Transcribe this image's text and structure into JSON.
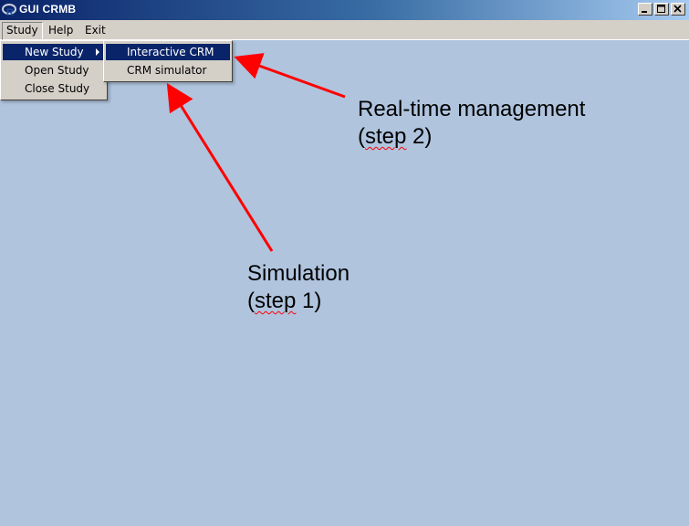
{
  "window": {
    "title": "GUI CRMB"
  },
  "menubar": {
    "items": [
      {
        "label": "Study"
      },
      {
        "label": "Help"
      },
      {
        "label": "Exit"
      }
    ]
  },
  "study_menu": {
    "items": [
      {
        "label": "New Study"
      },
      {
        "label": "Open Study"
      },
      {
        "label": "Close Study"
      }
    ]
  },
  "new_study_submenu": {
    "items": [
      {
        "label": "Interactive CRM"
      },
      {
        "label": "CRM simulator"
      }
    ]
  },
  "annotations": {
    "realtime": {
      "line1": "Real-time management",
      "line2_prefix": "(",
      "line2_word": "step",
      "line2_suffix": " 2)"
    },
    "simulation": {
      "line1": "Simulation",
      "line2_prefix": "(",
      "line2_word": "step",
      "line2_suffix": " 1)"
    }
  },
  "colors": {
    "workspace": "#b0c4de",
    "menu_highlight": "#0a246a",
    "arrow": "#ff0000"
  }
}
